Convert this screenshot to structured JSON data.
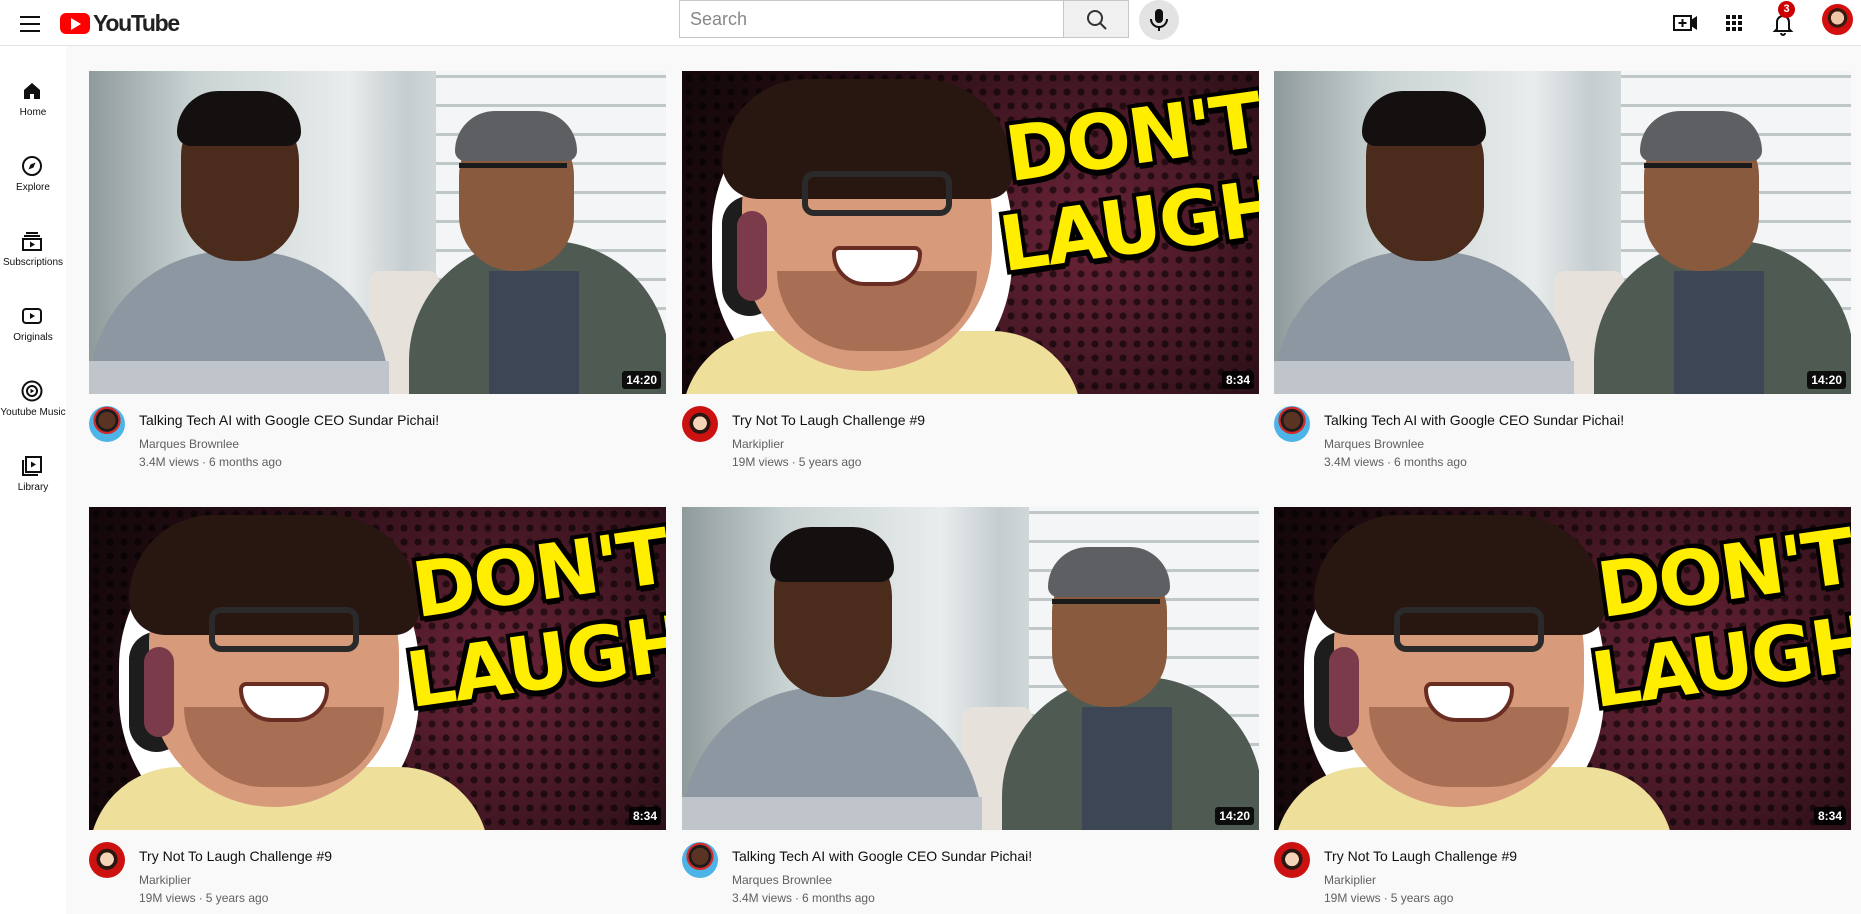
{
  "header": {
    "logo_text": "YouTube",
    "search_placeholder": "Search",
    "notification_count": "3",
    "icons": [
      "menu-icon",
      "search-icon",
      "mic-icon",
      "create-video-icon",
      "apps-grid-icon",
      "bell-icon",
      "account-avatar"
    ],
    "brand_color": "#ff0000"
  },
  "sidebar": {
    "items": [
      {
        "label": "Home",
        "icon": "home-icon"
      },
      {
        "label": "Explore",
        "icon": "explore-icon"
      },
      {
        "label": "Subscriptions",
        "icon": "subscriptions-icon"
      },
      {
        "label": "Originals",
        "icon": "originals-icon"
      },
      {
        "label": "Youtube Music",
        "icon": "music-icon"
      },
      {
        "label": "Library",
        "icon": "library-icon"
      }
    ]
  },
  "videos": [
    {
      "title": "Talking Tech AI with Google CEO Sundar Pichai!",
      "channel": "Marques Brownlee",
      "views": "3.4M views",
      "age": "6 months ago",
      "duration": "14:20",
      "thumb": "interview"
    },
    {
      "title": "Try Not To Laugh Challenge #9",
      "channel": "Markiplier",
      "views": "19M views",
      "age": "5 years ago",
      "duration": "8:34",
      "thumb": "dont-laugh",
      "thumb_text": [
        "DON'T",
        "LAUGH"
      ]
    },
    {
      "title": "Talking Tech AI with Google CEO Sundar Pichai!",
      "channel": "Marques Brownlee",
      "views": "3.4M views",
      "age": "6 months ago",
      "duration": "14:20",
      "thumb": "interview"
    },
    {
      "title": "Try Not To Laugh Challenge #9",
      "channel": "Markiplier",
      "views": "19M views",
      "age": "5 years ago",
      "duration": "8:34",
      "thumb": "dont-laugh",
      "thumb_text": [
        "DON'T",
        "LAUGH"
      ]
    },
    {
      "title": "Talking Tech AI with Google CEO Sundar Pichai!",
      "channel": "Marques Brownlee",
      "views": "3.4M views",
      "age": "6 months ago",
      "duration": "14:20",
      "thumb": "interview"
    },
    {
      "title": "Try Not To Laugh Challenge #9",
      "channel": "Markiplier",
      "views": "19M views",
      "age": "5 years ago",
      "duration": "8:34",
      "thumb": "dont-laugh",
      "thumb_text": [
        "DON'T",
        "LAUGH"
      ]
    }
  ]
}
